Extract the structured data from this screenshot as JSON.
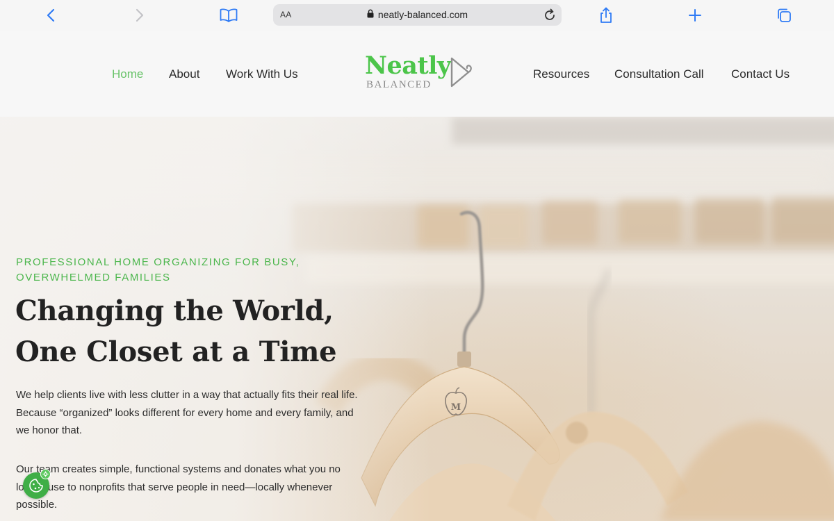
{
  "browser": {
    "text_size_label": "AA",
    "url": "neatly-balanced.com"
  },
  "site": {
    "logo": {
      "word": "Neatly",
      "sub": "BALANCED"
    },
    "nav_left": [
      "Home",
      "About",
      "Work With Us"
    ],
    "nav_right": [
      "Resources",
      "Consultation Call",
      "Contact Us"
    ],
    "active_nav": "Home",
    "accent_color": "#69c36a"
  },
  "hero": {
    "eyebrow": "PROFESSIONAL HOME ORGANIZING FOR BUSY, OVERWHELMED FAMILIES",
    "headline_line1": "Changing the World,",
    "headline_line2": "One Closet at a Time",
    "paragraph1": "We help clients live with less clutter in a way that actually fits their real life. Because “organized” looks different for every home and every family, and we honor that.",
    "paragraph2": "Our team creates simple, functional systems and donates what you no longer use to nonprofits that serve people in need—locally whenever possible.",
    "hanger_monogram": "M"
  }
}
